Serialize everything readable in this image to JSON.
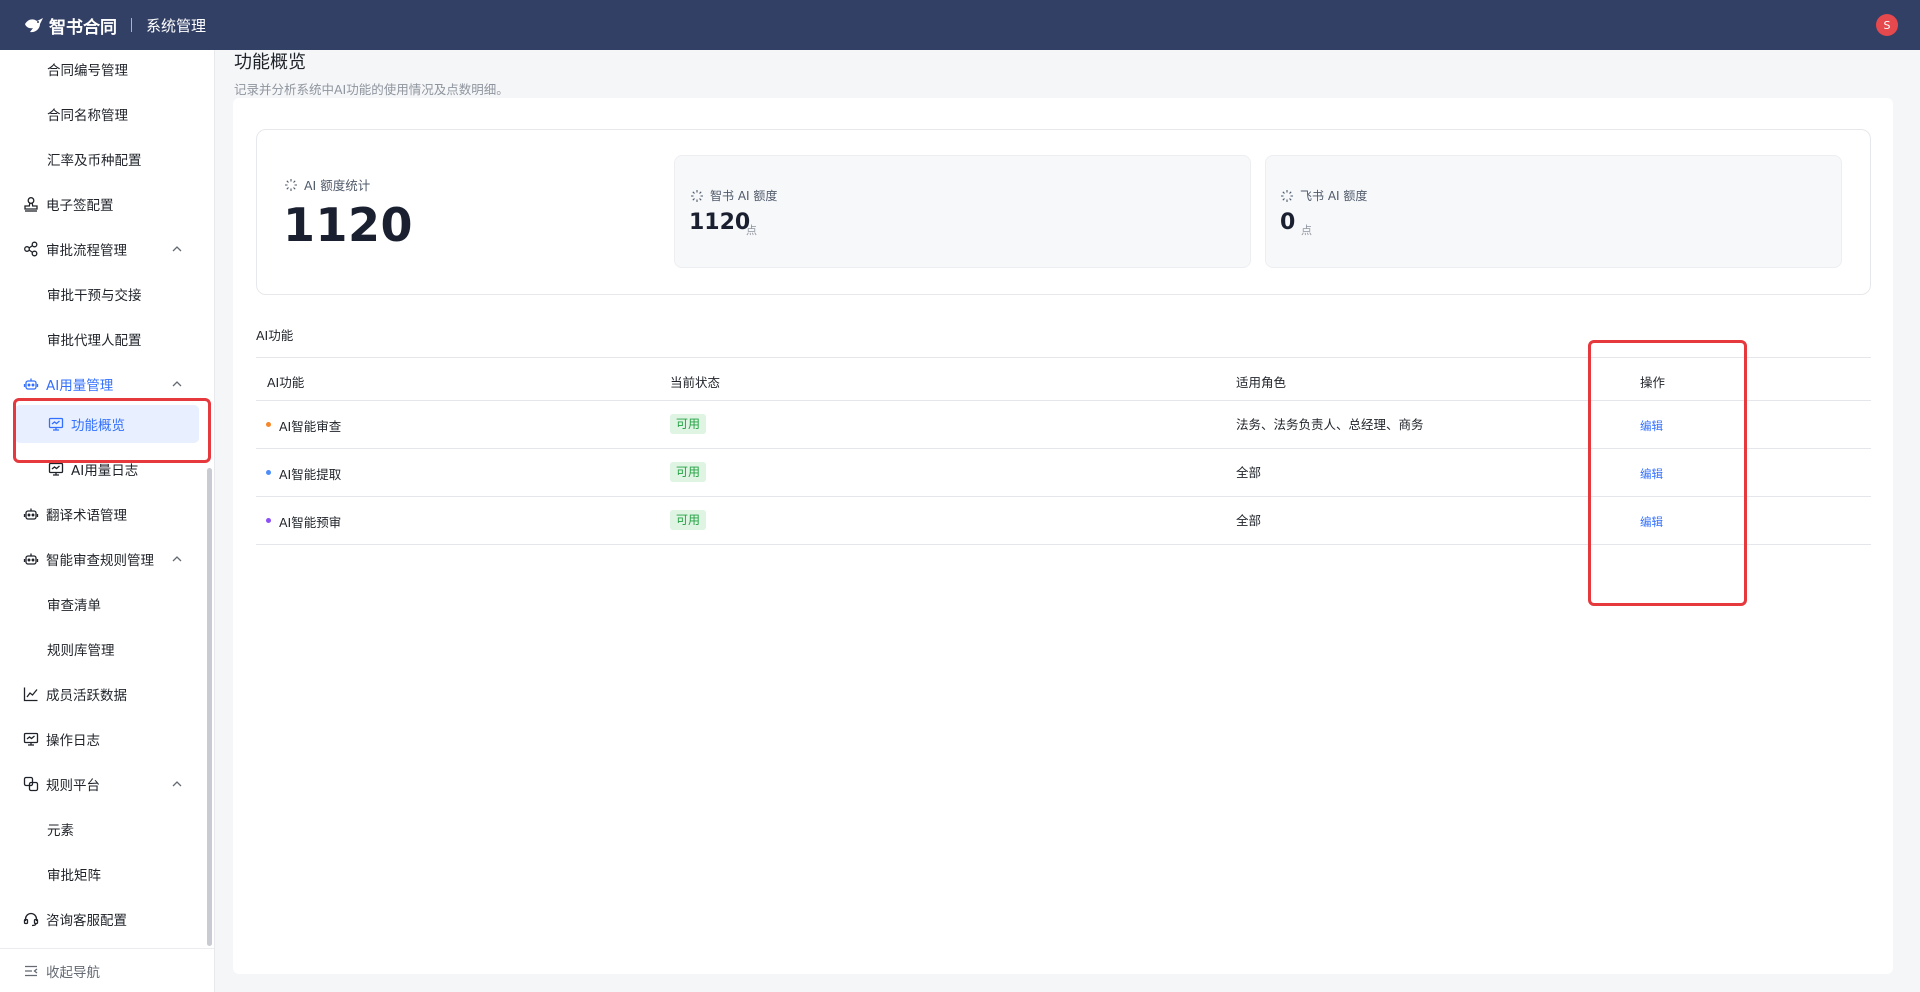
{
  "header": {
    "brand": "智书合同",
    "module": "系统管理",
    "avatar_initial": "S"
  },
  "sidebar": {
    "items": [
      {
        "label": "合同编号管理"
      },
      {
        "label": "合同名称管理"
      },
      {
        "label": "汇率及币种配置"
      },
      {
        "label": "电子签配置",
        "icon": "stamp-icon"
      },
      {
        "label": "审批流程管理",
        "icon": "flow-icon"
      },
      {
        "label": "审批干预与交接"
      },
      {
        "label": "审批代理人配置"
      },
      {
        "label": "AI用量管理",
        "icon": "robot-icon"
      },
      {
        "label": "功能概览",
        "icon": "monitor-icon"
      },
      {
        "label": "AI用量日志",
        "icon": "monitor-icon"
      },
      {
        "label": "翻译术语管理",
        "icon": "robot-icon"
      },
      {
        "label": "智能审查规则管理",
        "icon": "robot-icon"
      },
      {
        "label": "审查清单"
      },
      {
        "label": "规则库管理"
      },
      {
        "label": "成员活跃数据",
        "icon": "line-chart-icon"
      },
      {
        "label": "操作日志",
        "icon": "monitor-icon"
      },
      {
        "label": "规则平台",
        "icon": "squares-icon"
      },
      {
        "label": "元素"
      },
      {
        "label": "审批矩阵"
      },
      {
        "label": "咨询客服配置",
        "icon": "headset-icon"
      }
    ],
    "collapse_label": "收起导航"
  },
  "page": {
    "title": "功能概览",
    "description": "记录并分析系统中AI功能的使用情况及点数明细。"
  },
  "stats": {
    "total_label": "AI 额度统计",
    "total_value": "1120",
    "cards": [
      {
        "label": "智书 AI 额度",
        "value": "1120",
        "unit": "点"
      },
      {
        "label": "飞书 AI 额度",
        "value": "0",
        "unit": "点"
      }
    ]
  },
  "ai_section": {
    "title": "AI功能",
    "columns": [
      "AI功能",
      "当前状态",
      "适用角色",
      "操作"
    ],
    "rows": [
      {
        "name": "AI智能审查",
        "dot_color": "#f5872a",
        "status": "可用",
        "roles": "法务、法务负责人、总经理、商务",
        "action": "编辑"
      },
      {
        "name": "AI智能提取",
        "dot_color": "#4d8df7",
        "status": "可用",
        "roles": "全部",
        "action": "编辑"
      },
      {
        "name": "AI智能预审",
        "dot_color": "#8a4ff5",
        "status": "可用",
        "roles": "全部",
        "action": "编辑"
      }
    ]
  },
  "colors": {
    "header_bg": "#334065",
    "accent": "#3370ff",
    "highlight_box": "#e5393d",
    "tag_bg": "#dff4e3",
    "tag_text": "#25a244"
  }
}
